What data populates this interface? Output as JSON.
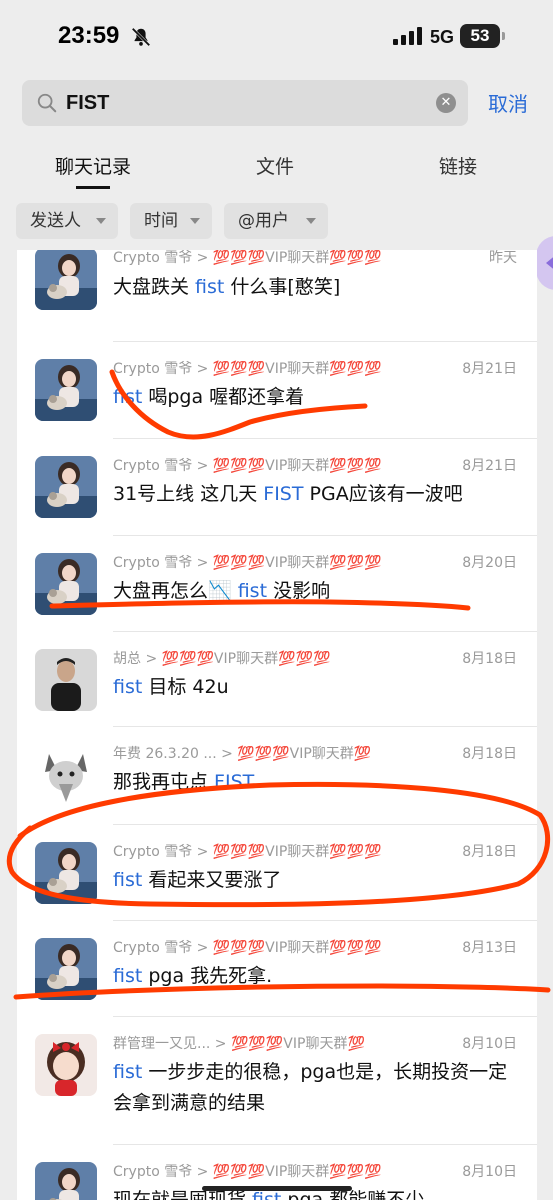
{
  "status_bar": {
    "time": "23:59",
    "network": "5G",
    "battery": "53"
  },
  "search": {
    "query": "FIST",
    "cancel_label": "取消",
    "clear_icon": "clear-icon"
  },
  "tabs": [
    {
      "label": "聊天记录",
      "active": true
    },
    {
      "label": "文件",
      "active": false
    },
    {
      "label": "链接",
      "active": false
    }
  ],
  "filters": [
    {
      "label": "发送人"
    },
    {
      "label": "时间"
    },
    {
      "label": "@用户"
    }
  ],
  "colors": {
    "accent": "#2a6bd6",
    "annotation": "#ff3b00",
    "background": "#ededed"
  },
  "results": [
    {
      "sender": "Crypto 雪爷",
      "chat": "💯💯💯VIP聊天群💯💯💯",
      "date": "昨天",
      "parts": [
        "大盘跌关 ",
        "fist",
        " 什么事[憨笑]"
      ],
      "avatar": "girl-avatar"
    },
    {
      "sender": "Crypto 雪爷",
      "chat": "💯💯💯VIP聊天群💯💯💯",
      "date": "8月21日",
      "parts": [
        "",
        "fist",
        " 喝pga 喔都还拿着"
      ],
      "avatar": "girl-avatar"
    },
    {
      "sender": "Crypto 雪爷",
      "chat": "💯💯💯VIP聊天群💯💯💯",
      "date": "8月21日",
      "parts": [
        "31号上线 这几天 ",
        "FIST",
        " PGA应该有一波吧"
      ],
      "avatar": "girl-avatar"
    },
    {
      "sender": "Crypto 雪爷",
      "chat": "💯💯💯VIP聊天群💯💯💯",
      "date": "8月20日",
      "parts": [
        "大盘再怎么📉 ",
        "fist",
        " 没影响"
      ],
      "avatar": "girl-avatar"
    },
    {
      "sender": "胡总",
      "chat": "💯💯💯VIP聊天群💯💯💯",
      "date": "8月18日",
      "parts": [
        "",
        "fist",
        " 目标 42u"
      ],
      "avatar": "man-avatar"
    },
    {
      "sender": "年费 26.3.20 ...",
      "chat": "💯💯💯VIP聊天群💯",
      "date": "8月18日",
      "parts": [
        "那我再屯点 ",
        "FIST",
        ""
      ],
      "avatar": "cat-avatar"
    },
    {
      "sender": "Crypto 雪爷",
      "chat": "💯💯💯VIP聊天群💯💯💯",
      "date": "8月18日",
      "parts": [
        "",
        "fist",
        " 看起来又要涨了"
      ],
      "avatar": "girl-avatar"
    },
    {
      "sender": "Crypto 雪爷",
      "chat": "💯💯💯VIP聊天群💯💯💯",
      "date": "8月13日",
      "parts": [
        "",
        "fist",
        " pga  我先死拿."
      ],
      "avatar": "girl-avatar"
    },
    {
      "sender": "群管理一又见...",
      "chat": "💯💯💯VIP聊天群💯",
      "date": "8月10日",
      "parts": [
        "",
        "fist",
        " 一步步走的很稳，pga也是，长期投资一定会拿到满意的结果"
      ],
      "avatar": "cartoon-girl-avatar"
    },
    {
      "sender": "Crypto 雪爷",
      "chat": "💯💯💯VIP聊天群💯💯💯",
      "date": "8月10日",
      "parts": [
        "现在就是囤现货  ",
        "fist",
        " pga 都能赚不少"
      ],
      "avatar": "girl-avatar"
    }
  ]
}
